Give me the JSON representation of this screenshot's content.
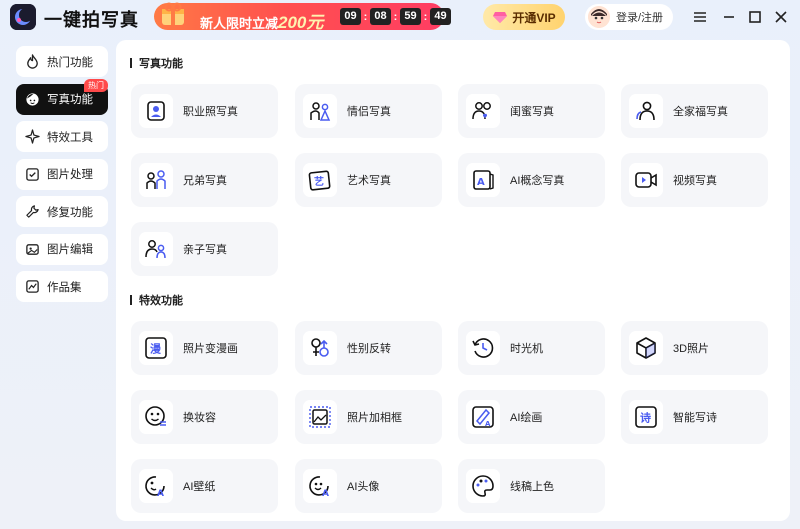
{
  "app": {
    "title": "一键拍写真"
  },
  "promo": {
    "text": "新人限时立减",
    "amount": "200元",
    "timer": [
      "09",
      "08",
      "59",
      "49"
    ]
  },
  "header": {
    "vip_label": "开通VIP",
    "login_label": "登录/注册"
  },
  "sidebar": {
    "items": [
      {
        "label": "热门功能",
        "icon": "fire-icon"
      },
      {
        "label": "写真功能",
        "icon": "face-icon",
        "badge": "热门"
      },
      {
        "label": "特效工具",
        "icon": "sparkle-icon"
      },
      {
        "label": "图片处理",
        "icon": "image-check-icon"
      },
      {
        "label": "修复功能",
        "icon": "wrench-icon"
      },
      {
        "label": "图片编辑",
        "icon": "image-edit-icon"
      },
      {
        "label": "作品集",
        "icon": "gallery-icon"
      }
    ]
  },
  "sections": [
    {
      "title": "写真功能",
      "cards": [
        {
          "label": "职业照写真",
          "icon": "id-photo-icon"
        },
        {
          "label": "情侣写真",
          "icon": "couple-icon"
        },
        {
          "label": "闺蜜写真",
          "icon": "bestie-icon"
        },
        {
          "label": "全家福写真",
          "icon": "family-icon"
        },
        {
          "label": "兄弟写真",
          "icon": "brothers-icon"
        },
        {
          "label": "艺术写真",
          "icon": "art-icon"
        },
        {
          "label": "AI概念写真",
          "icon": "ai-concept-icon"
        },
        {
          "label": "视频写真",
          "icon": "video-icon"
        },
        {
          "label": "亲子写真",
          "icon": "parent-child-icon"
        }
      ]
    },
    {
      "title": "特效功能",
      "cards": [
        {
          "label": "照片变漫画",
          "icon": "manga-icon"
        },
        {
          "label": "性别反转",
          "icon": "gender-icon"
        },
        {
          "label": "时光机",
          "icon": "time-machine-icon"
        },
        {
          "label": "3D照片",
          "icon": "cube-icon"
        },
        {
          "label": "换妆容",
          "icon": "makeup-icon"
        },
        {
          "label": "照片加相框",
          "icon": "frame-icon"
        },
        {
          "label": "AI绘画",
          "icon": "ai-paint-icon"
        },
        {
          "label": "智能写诗",
          "icon": "poem-icon"
        },
        {
          "label": "AI壁纸",
          "icon": "ai-wallpaper-icon"
        },
        {
          "label": "AI头像",
          "icon": "ai-avatar-icon"
        },
        {
          "label": "线稿上色",
          "icon": "palette-icon"
        }
      ]
    }
  ],
  "icon_glyphs": {
    "manga": "漫",
    "art": "艺",
    "poem": "诗",
    "ai_mark": "A"
  },
  "colors": {
    "accent": "#4a5cf0",
    "dark": "#111111",
    "promo": "#ff4f4f",
    "vip": "#ffd36e"
  }
}
